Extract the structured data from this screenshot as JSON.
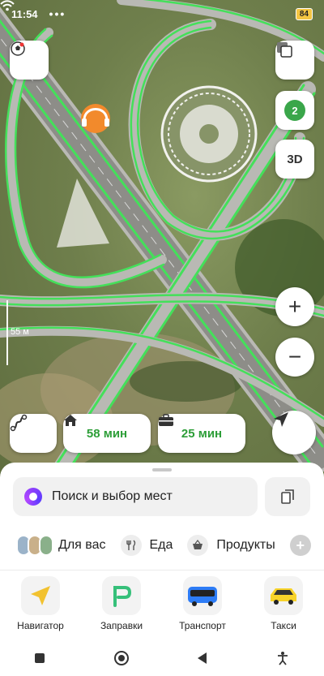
{
  "status_bar": {
    "time": "11:54",
    "dots": "•••",
    "battery": "84"
  },
  "map": {
    "scale_label": "55 м",
    "layers_badge": "2",
    "btn_3d": "3D",
    "zoom_in": "+",
    "zoom_out": "−"
  },
  "routes": {
    "home_time": "58 мин",
    "work_time": "25 мин"
  },
  "search": {
    "placeholder": "Поиск и выбор мест"
  },
  "categories": [
    {
      "label": "Для вас",
      "icon": "for-you-avatars-icon"
    },
    {
      "label": "Еда",
      "icon": "fork-knife-icon"
    },
    {
      "label": "Продукты",
      "icon": "basket-icon"
    }
  ],
  "apps": [
    {
      "label": "Навигатор",
      "icon": "navigator-icon",
      "color": "#f2c230"
    },
    {
      "label": "Заправки",
      "icon": "fuel-icon",
      "color": "#36c07a"
    },
    {
      "label": "Транспорт",
      "icon": "bus-icon",
      "color": "#2d7cf6"
    },
    {
      "label": "Такси",
      "icon": "taxi-icon",
      "color": "#f8d32a"
    }
  ],
  "colors": {
    "route_green": "#44e05a",
    "accent_green": "#2d9e38"
  }
}
